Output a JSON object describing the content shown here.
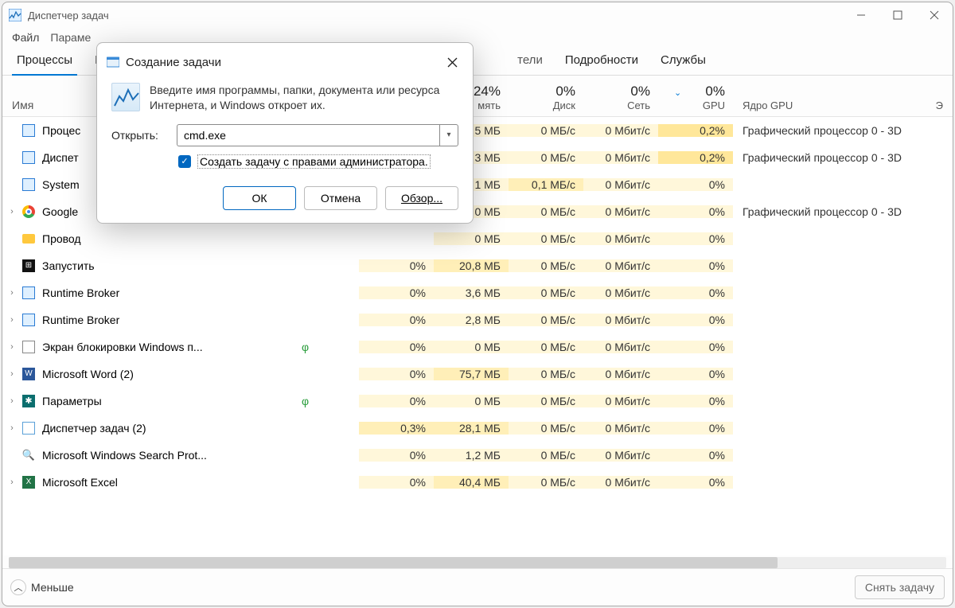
{
  "window": {
    "title": "Диспетчер задач"
  },
  "menubar": [
    "Файл",
    "Параме"
  ],
  "tabs": {
    "items": [
      "Процессы",
      "Пр",
      "тели",
      "Подробности",
      "Службы"
    ],
    "active_index": 0
  },
  "columns": {
    "name": "Имя",
    "e_blank": "",
    "cpu": {
      "pct": "",
      "label": ""
    },
    "memory": {
      "pct": "24%",
      "label": "мять"
    },
    "disk": {
      "pct": "0%",
      "label": "Диск"
    },
    "net": {
      "pct": "0%",
      "label": "Сеть"
    },
    "gpu": {
      "pct": "0%",
      "label": "GPU"
    },
    "gcore": "Ядро GPU",
    "end": "Э"
  },
  "rows": [
    {
      "exp": "",
      "icon": "sys",
      "name": "Процес",
      "leaf": false,
      "cpu": "",
      "mem": "5 МБ",
      "disk": "0 МБ/с",
      "net": "0 Мбит/с",
      "gpu": "0,2%",
      "gcore": "Графический процессор 0 - 3D",
      "mem_t": 1,
      "disk_t": 1,
      "net_t": 1,
      "gpu_t": 3
    },
    {
      "exp": "",
      "icon": "sys",
      "name": "Диспет",
      "leaf": false,
      "cpu": "",
      "mem": "3 МБ",
      "disk": "0 МБ/с",
      "net": "0 Мбит/с",
      "gpu": "0,2%",
      "gcore": "Графический процессор 0 - 3D",
      "mem_t": 1,
      "disk_t": 1,
      "net_t": 1,
      "gpu_t": 3
    },
    {
      "exp": "",
      "icon": "sys",
      "name": "System",
      "leaf": false,
      "cpu": "",
      "mem": "1 МБ",
      "disk": "0,1 МБ/с",
      "net": "0 Мбит/с",
      "gpu": "0%",
      "gcore": "",
      "mem_t": 1,
      "disk_t": 2,
      "net_t": 1,
      "gpu_t": 1
    },
    {
      "exp": "›",
      "icon": "chrome",
      "name": "Google",
      "leaf": false,
      "cpu": "",
      "mem": "0 МБ",
      "disk": "0 МБ/с",
      "net": "0 Мбит/с",
      "gpu": "0%",
      "gcore": "Графический процессор 0 - 3D",
      "mem_t": 1,
      "disk_t": 1,
      "net_t": 1,
      "gpu_t": 1
    },
    {
      "exp": "",
      "icon": "folder",
      "name": "Провод",
      "leaf": false,
      "cpu": "",
      "mem": "0 МБ",
      "disk": "0 МБ/с",
      "net": "0 Мбит/с",
      "gpu": "0%",
      "gcore": "",
      "mem_t": 1,
      "disk_t": 1,
      "net_t": 1,
      "gpu_t": 1
    },
    {
      "exp": "",
      "icon": "win",
      "name": "Запустить",
      "leaf": false,
      "cpu": "0%",
      "mem": "20,8 МБ",
      "disk": "0 МБ/с",
      "net": "0 Мбит/с",
      "gpu": "0%",
      "gcore": "",
      "cpu_t": 1,
      "mem_t": 2,
      "disk_t": 1,
      "net_t": 1,
      "gpu_t": 1
    },
    {
      "exp": "›",
      "icon": "sys",
      "name": "Runtime Broker",
      "leaf": false,
      "cpu": "0%",
      "mem": "3,6 МБ",
      "disk": "0 МБ/с",
      "net": "0 Мбит/с",
      "gpu": "0%",
      "gcore": "",
      "cpu_t": 1,
      "mem_t": 1,
      "disk_t": 1,
      "net_t": 1,
      "gpu_t": 1
    },
    {
      "exp": "›",
      "icon": "sys",
      "name": "Runtime Broker",
      "leaf": false,
      "cpu": "0%",
      "mem": "2,8 МБ",
      "disk": "0 МБ/с",
      "net": "0 Мбит/с",
      "gpu": "0%",
      "gcore": "",
      "cpu_t": 1,
      "mem_t": 1,
      "disk_t": 1,
      "net_t": 1,
      "gpu_t": 1
    },
    {
      "exp": "›",
      "icon": "blank",
      "name": "Экран блокировки Windows п...",
      "leaf": true,
      "cpu": "0%",
      "mem": "0 МБ",
      "disk": "0 МБ/с",
      "net": "0 Мбит/с",
      "gpu": "0%",
      "gcore": "",
      "cpu_t": 1,
      "mem_t": 1,
      "disk_t": 1,
      "net_t": 1,
      "gpu_t": 1
    },
    {
      "exp": "›",
      "icon": "word",
      "name": "Microsoft Word (2)",
      "leaf": false,
      "cpu": "0%",
      "mem": "75,7 МБ",
      "disk": "0 МБ/с",
      "net": "0 Мбит/с",
      "gpu": "0%",
      "gcore": "",
      "cpu_t": 1,
      "mem_t": 2,
      "disk_t": 1,
      "net_t": 1,
      "gpu_t": 1
    },
    {
      "exp": "›",
      "icon": "gear",
      "name": "Параметры",
      "leaf": true,
      "cpu": "0%",
      "mem": "0 МБ",
      "disk": "0 МБ/с",
      "net": "0 Мбит/с",
      "gpu": "0%",
      "gcore": "",
      "cpu_t": 1,
      "mem_t": 1,
      "disk_t": 1,
      "net_t": 1,
      "gpu_t": 1
    },
    {
      "exp": "›",
      "icon": "tm",
      "name": "Диспетчер задач (2)",
      "leaf": false,
      "cpu": "0,3%",
      "mem": "28,1 МБ",
      "disk": "0 МБ/с",
      "net": "0 Мбит/с",
      "gpu": "0%",
      "gcore": "",
      "cpu_t": 2,
      "mem_t": 2,
      "disk_t": 1,
      "net_t": 1,
      "gpu_t": 1
    },
    {
      "exp": "",
      "icon": "mag",
      "name": "Microsoft Windows Search Prot...",
      "leaf": false,
      "cpu": "0%",
      "mem": "1,2 МБ",
      "disk": "0 МБ/с",
      "net": "0 Мбит/с",
      "gpu": "0%",
      "gcore": "",
      "cpu_t": 1,
      "mem_t": 1,
      "disk_t": 1,
      "net_t": 1,
      "gpu_t": 1
    },
    {
      "exp": "›",
      "icon": "excel",
      "name": "Microsoft Excel",
      "leaf": false,
      "cpu": "0%",
      "mem": "40,4 МБ",
      "disk": "0 МБ/с",
      "net": "0 Мбит/с",
      "gpu": "0%",
      "gcore": "",
      "cpu_t": 1,
      "mem_t": 2,
      "disk_t": 1,
      "net_t": 1,
      "gpu_t": 1
    }
  ],
  "footer": {
    "fewer": "Меньше",
    "end_task": "Снять задачу"
  },
  "dialog": {
    "title": "Создание задачи",
    "description": "Введите имя программы, папки, документа или ресурса Интернета, и Windows откроет их.",
    "open_label": "Открыть:",
    "open_value": "cmd.exe",
    "admin_label": "Создать задачу с правами администратора.",
    "admin_checked": true,
    "ok": "ОК",
    "cancel": "Отмена",
    "browse": "Обзор..."
  }
}
